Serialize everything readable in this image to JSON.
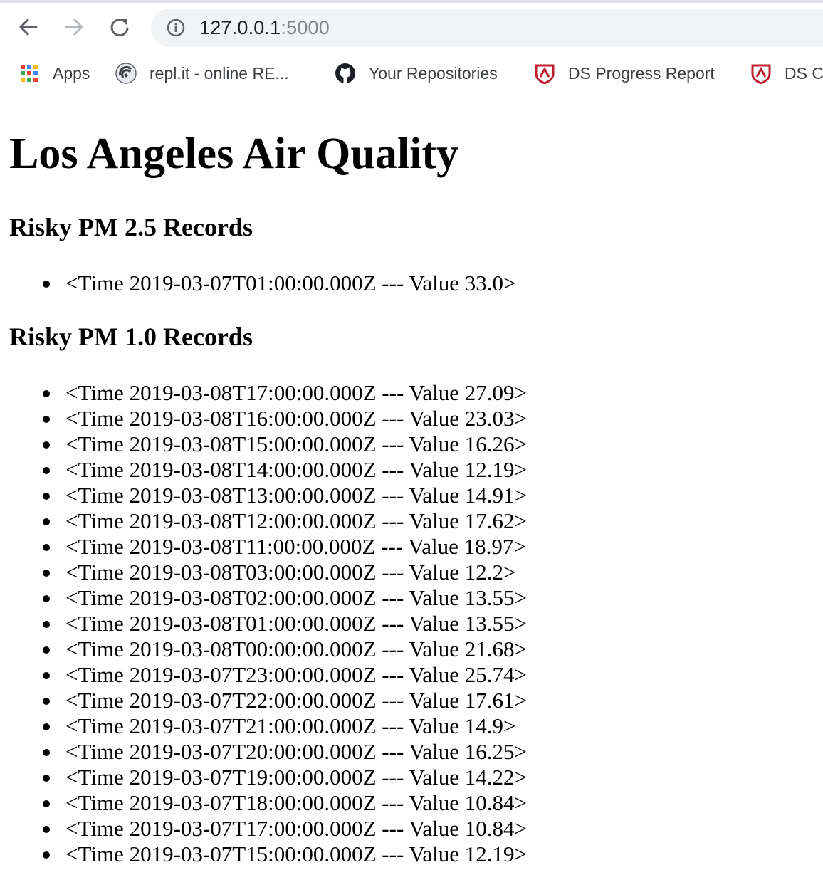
{
  "browser": {
    "url_host": "127.0.0.1",
    "url_port": ":5000",
    "bookmarks": [
      {
        "label": "Apps",
        "icon": "apps-grid-icon"
      },
      {
        "label": "repl.it - online RE...",
        "icon": "replit-icon"
      },
      {
        "label": "Your Repositories",
        "icon": "github-icon"
      },
      {
        "label": "DS Progress Report",
        "icon": "lambda-shield-icon"
      },
      {
        "label": "DS C",
        "icon": "lambda-shield-icon"
      }
    ]
  },
  "page": {
    "title": "Los Angeles Air Quality",
    "pm25_heading": "Risky PM 2.5 Records",
    "pm25_records": [
      "<Time 2019-03-07T01:00:00.000Z --- Value 33.0>"
    ],
    "pm10_heading": "Risky PM 1.0 Records",
    "pm10_records": [
      "<Time 2019-03-08T17:00:00.000Z --- Value 27.09>",
      "<Time 2019-03-08T16:00:00.000Z --- Value 23.03>",
      "<Time 2019-03-08T15:00:00.000Z --- Value 16.26>",
      "<Time 2019-03-08T14:00:00.000Z --- Value 12.19>",
      "<Time 2019-03-08T13:00:00.000Z --- Value 14.91>",
      "<Time 2019-03-08T12:00:00.000Z --- Value 17.62>",
      "<Time 2019-03-08T11:00:00.000Z --- Value 18.97>",
      "<Time 2019-03-08T03:00:00.000Z --- Value 12.2>",
      "<Time 2019-03-08T02:00:00.000Z --- Value 13.55>",
      "<Time 2019-03-08T01:00:00.000Z --- Value 13.55>",
      "<Time 2019-03-08T00:00:00.000Z --- Value 21.68>",
      "<Time 2019-03-07T23:00:00.000Z --- Value 25.74>",
      "<Time 2019-03-07T22:00:00.000Z --- Value 17.61>",
      "<Time 2019-03-07T21:00:00.000Z --- Value 14.9>",
      "<Time 2019-03-07T20:00:00.000Z --- Value 16.25>",
      "<Time 2019-03-07T19:00:00.000Z --- Value 14.22>",
      "<Time 2019-03-07T18:00:00.000Z --- Value 10.84>",
      "<Time 2019-03-07T17:00:00.000Z --- Value 10.84>",
      "<Time 2019-03-07T15:00:00.000Z --- Value 12.19>"
    ]
  }
}
